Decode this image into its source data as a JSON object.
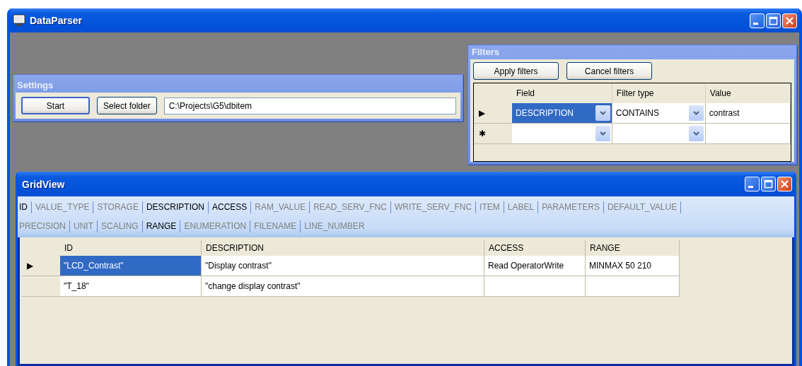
{
  "window": {
    "title": "DataParser"
  },
  "settings": {
    "title": "Settings",
    "buttons": [
      "Start",
      "Select folder"
    ],
    "folder_field": {
      "value": "C:\\Projects\\G5\\dbitem"
    }
  },
  "filters": {
    "title": "Filters",
    "buttons": [
      "Apply filters",
      "Cancel filters"
    ],
    "columns": [
      "Field",
      "Filter type",
      "Value"
    ],
    "rows": [
      {
        "marker": "▶",
        "cells": [
          {
            "kind": "dropdown",
            "text": "DESCRIPTION",
            "selected": true
          },
          {
            "kind": "dropdown",
            "text": "CONTAINS",
            "selected": false
          },
          {
            "kind": "text",
            "text": "contrast",
            "selected": false
          }
        ]
      },
      {
        "marker": "✱",
        "cells": [
          {
            "kind": "dropdown",
            "selected": false
          },
          {
            "kind": "dropdown",
            "selected": false
          },
          {
            "kind": "text",
            "selected": false
          }
        ]
      }
    ]
  },
  "grid_view": {
    "title": "GridView",
    "column_toggle_lines": [
      [
        {
          "label": "ID",
          "on": true
        },
        {
          "label": "VALUE_TYPE",
          "on": false
        },
        {
          "label": "STORAGE",
          "on": false
        },
        {
          "label": "DESCRIPTION",
          "on": true
        },
        {
          "label": "ACCESS",
          "on": true
        },
        {
          "label": "RAM_VALUE",
          "on": false
        },
        {
          "label": "READ_SERV_FNC",
          "on": false
        },
        {
          "label": "WRITE_SERV_FNC",
          "on": false
        },
        {
          "label": "ITEM",
          "on": false
        },
        {
          "label": "LABEL",
          "on": false
        },
        {
          "label": "PARAMETERS",
          "on": false
        },
        {
          "label": "DEFAULT_VALUE",
          "on": false
        }
      ],
      [
        {
          "label": "PRECISION",
          "on": false
        },
        {
          "label": "UNIT",
          "on": false
        },
        {
          "label": "SCALING",
          "on": false
        },
        {
          "label": "RANGE",
          "on": true
        },
        {
          "label": "ENUMERATION",
          "on": false
        },
        {
          "label": "FILENAME",
          "on": false
        },
        {
          "label": "LINE_NUMBER",
          "on": false
        }
      ]
    ],
    "columns": [
      "ID",
      "DESCRIPTION",
      "ACCESS",
      "RANGE"
    ],
    "rows": [
      {
        "marker": "▶",
        "cells": [
          {
            "text": "\"LCD_Contrast\"",
            "selected": true
          },
          {
            "text": "\"Display contrast\"",
            "selected": false
          },
          {
            "text": "Read OperatorWrite",
            "selected": false
          },
          {
            "text": "MINMAX 50 210",
            "selected": false
          }
        ]
      },
      {
        "cells": [
          {
            "text": "\"T_18\"",
            "selected": false
          },
          {
            "text": "\"change display contrast\"",
            "selected": false
          },
          {
            "selected": false
          },
          {
            "selected": false
          }
        ]
      }
    ]
  }
}
